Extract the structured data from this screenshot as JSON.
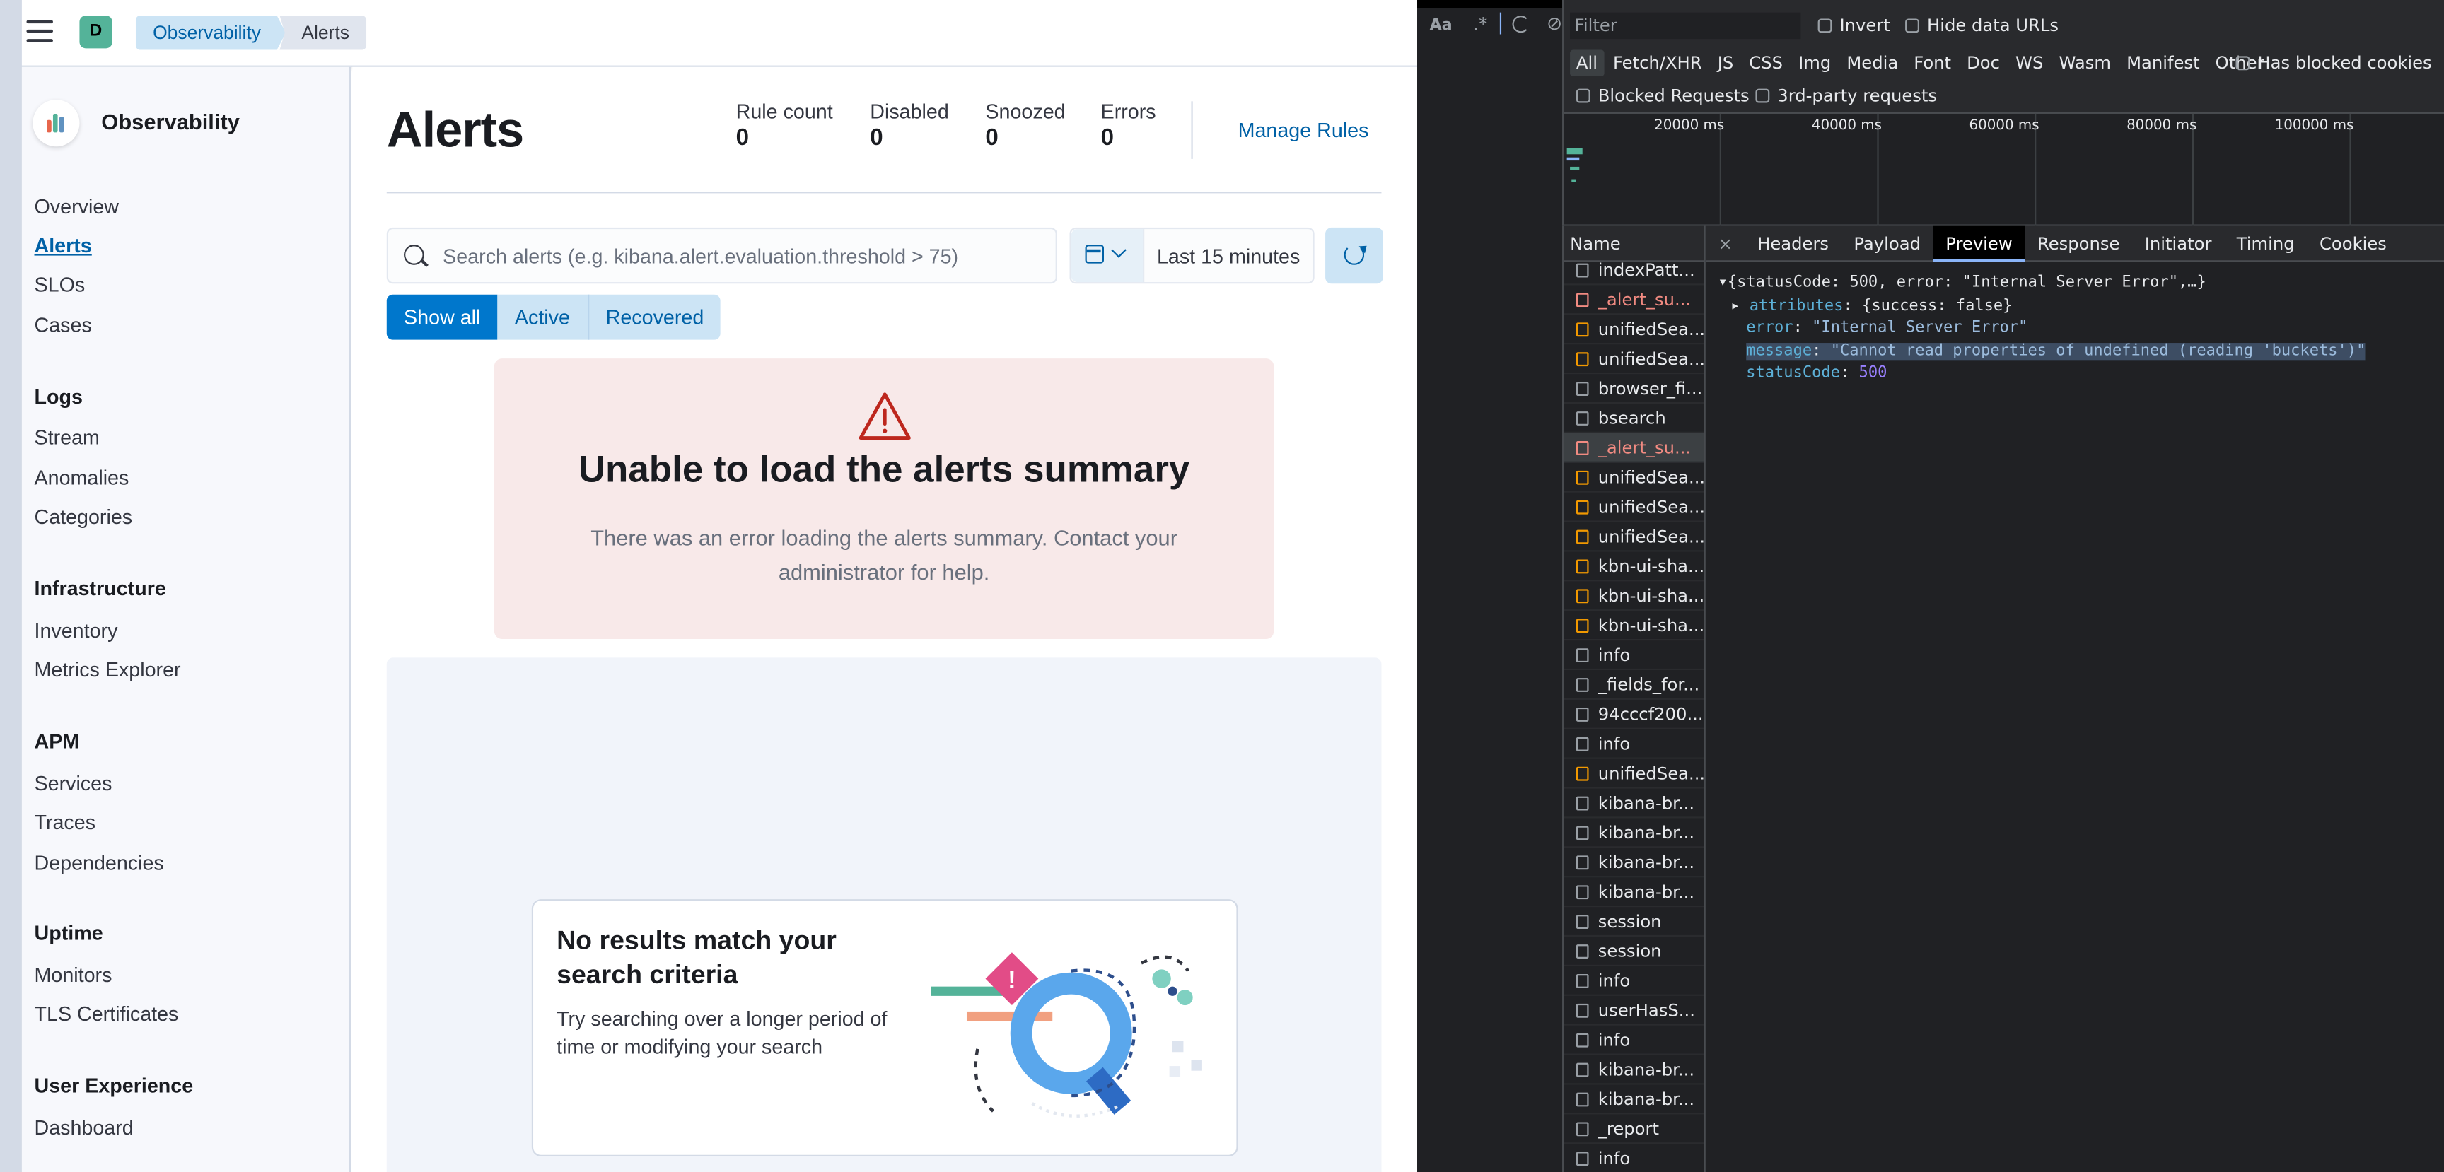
{
  "header": {
    "space_initial": "D",
    "breadcrumbs": [
      "Observability",
      "Alerts"
    ]
  },
  "sidebar": {
    "title": "Observability",
    "top_items": [
      "Overview",
      "Alerts",
      "SLOs",
      "Cases"
    ],
    "active_item": "Alerts",
    "sections": [
      {
        "heading": "Logs",
        "items": [
          "Stream",
          "Anomalies",
          "Categories"
        ]
      },
      {
        "heading": "Infrastructure",
        "items": [
          "Inventory",
          "Metrics Explorer"
        ]
      },
      {
        "heading": "APM",
        "items": [
          "Services",
          "Traces",
          "Dependencies"
        ]
      },
      {
        "heading": "Uptime",
        "items": [
          "Monitors",
          "TLS Certificates"
        ]
      },
      {
        "heading": "User Experience",
        "items": [
          "Dashboard"
        ]
      }
    ]
  },
  "main": {
    "title": "Alerts",
    "stats": [
      {
        "label": "Rule count",
        "value": "0"
      },
      {
        "label": "Disabled",
        "value": "0"
      },
      {
        "label": "Snoozed",
        "value": "0"
      },
      {
        "label": "Errors",
        "value": "0"
      }
    ],
    "manage_rules": "Manage Rules",
    "search_placeholder": "Search alerts (e.g. kibana.alert.evaluation.threshold > 75)",
    "date_range": "Last 15 minutes",
    "filters": [
      "Show all",
      "Active",
      "Recovered"
    ],
    "error": {
      "title": "Unable to load the alerts summary",
      "body": "There was an error loading the alerts summary. Contact your administrator for help."
    },
    "empty": {
      "title": "No results match your search criteria",
      "body": "Try searching over a longer period of time or modifying your search"
    }
  },
  "devtools": {
    "toolbar": {
      "case_toggle": "Aa",
      "regex_toggle": ".*"
    },
    "filter_placeholder": "Filter",
    "checks_row1": [
      "Invert",
      "Hide data URLs"
    ],
    "types": [
      "All",
      "Fetch/XHR",
      "JS",
      "CSS",
      "Img",
      "Media",
      "Font",
      "Doc",
      "WS",
      "Wasm",
      "Manifest",
      "Other"
    ],
    "blocked_cookies": "Has blocked cookies",
    "checks_row3": [
      "Blocked Requests",
      "3rd-party requests"
    ],
    "timeline_ticks": [
      "20000 ms",
      "40000 ms",
      "60000 ms",
      "80000 ms",
      "100000 ms"
    ],
    "names_header": "Name",
    "rows": [
      {
        "name": "indexPatt...",
        "kind": "doc"
      },
      {
        "name": "_alert_su...",
        "kind": "err"
      },
      {
        "name": "unifiedSea...",
        "kind": "js"
      },
      {
        "name": "unifiedSea...",
        "kind": "js"
      },
      {
        "name": "browser_fi...",
        "kind": "doc"
      },
      {
        "name": "bsearch",
        "kind": "doc"
      },
      {
        "name": "_alert_su...",
        "kind": "err-selected"
      },
      {
        "name": "unifiedSea...",
        "kind": "js"
      },
      {
        "name": "unifiedSea...",
        "kind": "js"
      },
      {
        "name": "unifiedSea...",
        "kind": "js"
      },
      {
        "name": "kbn-ui-sha...",
        "kind": "js"
      },
      {
        "name": "kbn-ui-sha...",
        "kind": "js"
      },
      {
        "name": "kbn-ui-sha...",
        "kind": "js"
      },
      {
        "name": "info",
        "kind": "doc"
      },
      {
        "name": "_fields_for...",
        "kind": "doc"
      },
      {
        "name": "94cccf200...",
        "kind": "img"
      },
      {
        "name": "info",
        "kind": "doc"
      },
      {
        "name": "unifiedSea...",
        "kind": "js"
      },
      {
        "name": "kibana-br...",
        "kind": "doc"
      },
      {
        "name": "kibana-br...",
        "kind": "doc"
      },
      {
        "name": "kibana-br...",
        "kind": "doc"
      },
      {
        "name": "kibana-br...",
        "kind": "doc"
      },
      {
        "name": "session",
        "kind": "doc"
      },
      {
        "name": "session",
        "kind": "doc"
      },
      {
        "name": "info",
        "kind": "doc"
      },
      {
        "name": "userHasS...",
        "kind": "doc"
      },
      {
        "name": "info",
        "kind": "doc"
      },
      {
        "name": "kibana-br...",
        "kind": "doc"
      },
      {
        "name": "kibana-br...",
        "kind": "doc"
      },
      {
        "name": "_report",
        "kind": "doc"
      },
      {
        "name": "info",
        "kind": "doc"
      }
    ],
    "detail_close": "×",
    "detail_tabs": [
      "Headers",
      "Payload",
      "Preview",
      "Response",
      "Initiator",
      "Timing",
      "Cookies"
    ],
    "active_tab": "Preview",
    "json": {
      "summary": "{statusCode: 500, error: \"Internal Server Error\",…}",
      "attributes_key": "attributes",
      "attributes_value": "{success: false}",
      "error_key": "error",
      "error_value": "\"Internal Server Error\"",
      "message_key": "message",
      "message_value": "\"Cannot read properties of undefined (reading 'buckets')\"",
      "status_key": "statusCode",
      "status_value": "500"
    }
  }
}
